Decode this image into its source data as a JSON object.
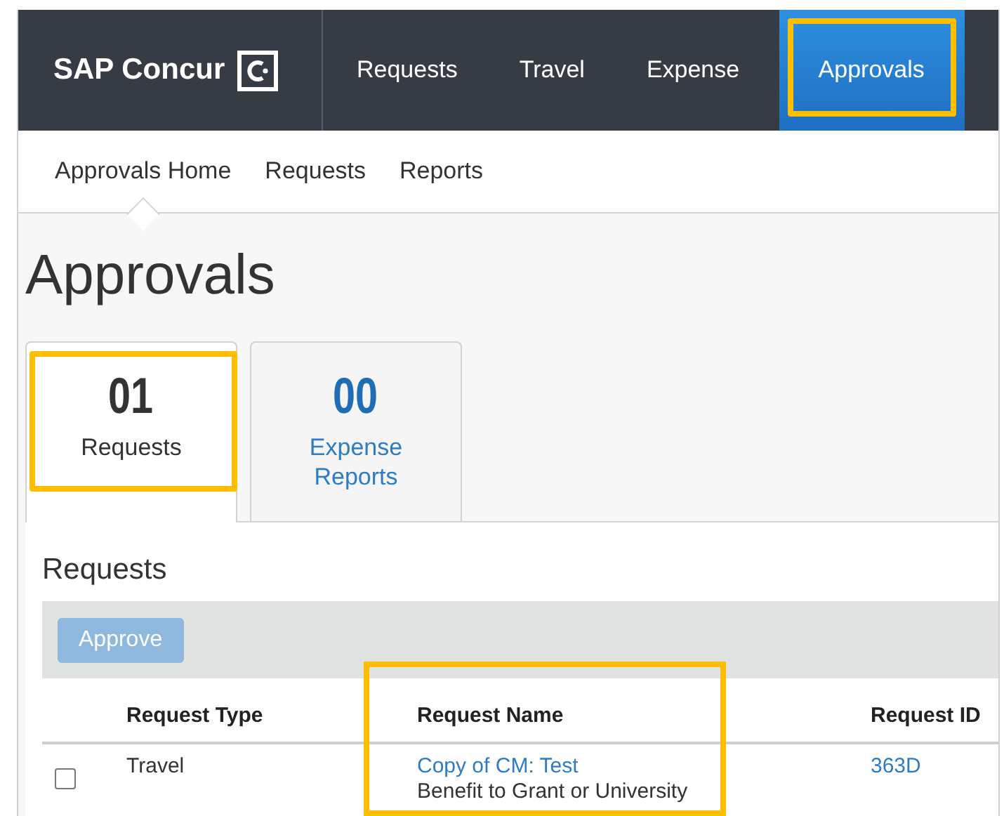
{
  "brand": "SAP Concur",
  "nav": [
    {
      "label": "Requests",
      "selected": false,
      "highlighted": false
    },
    {
      "label": "Travel",
      "selected": false,
      "highlighted": false
    },
    {
      "label": "Expense",
      "selected": false,
      "highlighted": false
    },
    {
      "label": "Approvals",
      "selected": true,
      "highlighted": true
    }
  ],
  "subnav": [
    {
      "label": "Approvals Home",
      "selected": true
    },
    {
      "label": "Requests",
      "selected": false
    },
    {
      "label": "Reports",
      "selected": false
    }
  ],
  "title": "Approvals",
  "tiles": [
    {
      "count": "01",
      "label": "Requests",
      "selected": true,
      "highlighted": true
    },
    {
      "count": "00",
      "label": "Expense Reports",
      "selected": false,
      "highlighted": false
    }
  ],
  "section_title": "Requests",
  "approve_button": {
    "label": "Approve",
    "disabled": true
  },
  "table": {
    "columns": [
      {
        "label": "Request Type",
        "highlighted": false
      },
      {
        "label": "Request Name",
        "highlighted": true
      },
      {
        "label": "Request ID",
        "highlighted": false
      }
    ],
    "rows": [
      {
        "checked": false,
        "request_type": "Travel",
        "request_name": "Copy of CM: Test",
        "purpose": "Benefit to Grant or University",
        "request_id": "363D"
      }
    ]
  }
}
